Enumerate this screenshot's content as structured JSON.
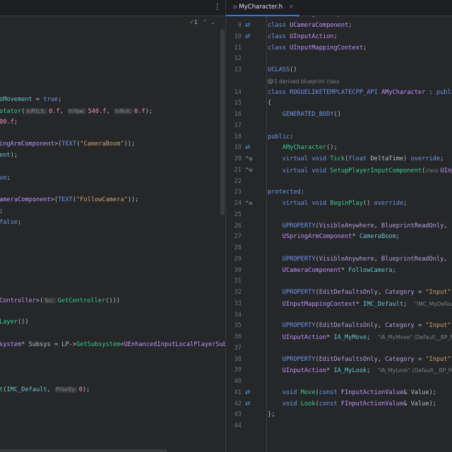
{
  "left_pane": {
    "menu_icon": "kebab-menu-icon",
    "inspection": {
      "count": "1",
      "check_icon": "check-icon",
      "up_icon": "chevron-up-icon",
      "down_icon": "chevron-down-icon"
    },
    "lines": [
      [],
      [],
      [],
      [],
      [],
      [],
      [],
      [
        [
          "oMovement",
          "v"
        ],
        [
          " = ",
          "p"
        ],
        [
          "true",
          "k"
        ],
        [
          ";",
          "p"
        ]
      ],
      [
        [
          "otator",
          "f"
        ],
        [
          "(",
          "p"
        ],
        [
          "InPitch:",
          "h"
        ],
        [
          "0.f",
          "n"
        ],
        [
          ", ",
          "p"
        ],
        [
          "InYaw:",
          "h"
        ],
        [
          "540.f",
          "n"
        ],
        [
          ", ",
          "p"
        ],
        [
          "InRoll:",
          "h"
        ],
        [
          "0.f",
          "n"
        ],
        [
          ");",
          "p"
        ]
      ],
      [
        [
          "00.f",
          "n"
        ],
        [
          ";",
          "p"
        ]
      ],
      [],
      [
        [
          "ingArmComponent",
          "c"
        ],
        [
          ">(",
          "p"
        ],
        [
          "TEXT",
          "m"
        ],
        [
          "(",
          "p"
        ],
        [
          "\"CameraBoom\"",
          "s"
        ],
        [
          "));",
          "p"
        ]
      ],
      [
        [
          "ent",
          "v"
        ],
        [
          ");",
          "p"
        ]
      ],
      [],
      [
        [
          "ue",
          "k"
        ],
        [
          ";",
          "p"
        ]
      ],
      [],
      [
        [
          "ameraComponent",
          "c"
        ],
        [
          ">(",
          "p"
        ],
        [
          "TEXT",
          "m"
        ],
        [
          "(",
          "p"
        ],
        [
          "\"FollowCamera\"",
          "s"
        ],
        [
          "));",
          "p"
        ]
      ],
      [
        [
          ";",
          "p"
        ]
      ],
      [
        [
          "false",
          "k"
        ],
        [
          ";",
          "p"
        ]
      ],
      [],
      [],
      [],
      [],
      [],
      [],
      [
        [
          "Controller",
          "c"
        ],
        [
          ">(",
          "p"
        ],
        [
          "Src:",
          "h"
        ],
        [
          "GetController",
          "f"
        ],
        [
          "()))",
          "p"
        ]
      ],
      [],
      [
        [
          "Layer",
          "f"
        ],
        [
          "())",
          "p"
        ]
      ],
      [],
      [
        [
          "system",
          "c"
        ],
        [
          "* ",
          "p"
        ],
        [
          "Subsys",
          "p"
        ],
        [
          " = LP->",
          "p"
        ],
        [
          "GetSubsystem",
          "f"
        ],
        [
          "<",
          "p"
        ],
        [
          "UEnhancedInputLocalPlayerSub",
          "c"
        ]
      ],
      [],
      [],
      [],
      [
        [
          "t",
          "f"
        ],
        [
          "(",
          "p"
        ],
        [
          "IMC_Default",
          "v"
        ],
        [
          ", ",
          "p"
        ],
        [
          "Priority:",
          "h"
        ],
        [
          "0",
          "n"
        ],
        [
          ");",
          "p"
        ]
      ]
    ]
  },
  "right_pane": {
    "tab": {
      "icon_label": ".H",
      "title": "MyCharacter.h",
      "close": "×"
    },
    "lines": [
      {
        "n": "8",
        "icon": "⇄",
        "t": [
          [
            "class ",
            "k"
          ],
          [
            "USpringArmComponent",
            "c"
          ],
          [
            ";",
            "p"
          ]
        ]
      },
      {
        "n": "9",
        "icon": "⇄",
        "t": [
          [
            "class ",
            "k"
          ],
          [
            "UCameraComponent",
            "c"
          ],
          [
            ";",
            "p"
          ]
        ]
      },
      {
        "n": "10",
        "icon": "⇄",
        "t": [
          [
            "class ",
            "k"
          ],
          [
            "UInputAction",
            "c"
          ],
          [
            ";",
            "p"
          ]
        ]
      },
      {
        "n": "11",
        "t": [
          [
            "class ",
            "k"
          ],
          [
            "UInputMappingContext",
            "c"
          ],
          [
            ";",
            "p"
          ]
        ]
      },
      {
        "n": "12",
        "t": []
      },
      {
        "n": "13",
        "t": [
          [
            "UCLASS",
            "m"
          ],
          [
            "()",
            "p"
          ]
        ]
      },
      {
        "n": "",
        "hint": "1 derived blueprint class",
        "t": []
      },
      {
        "n": "14",
        "t": [
          [
            "class ",
            "k"
          ],
          [
            "ROGUELIKETEMPLATECPP_API ",
            "k"
          ],
          [
            "AMyCharacter",
            "c"
          ],
          [
            " : ",
            "p"
          ],
          [
            "public",
            "k"
          ]
        ]
      },
      {
        "n": "15",
        "t": [
          [
            "{",
            "p"
          ]
        ]
      },
      {
        "n": "16",
        "t": [
          [
            "    ",
            "p"
          ],
          [
            "GENERATED_BODY",
            "m"
          ],
          [
            "()",
            "p"
          ]
        ]
      },
      {
        "n": "17",
        "t": []
      },
      {
        "n": "18",
        "t": [
          [
            "public",
            "k"
          ],
          [
            ":",
            "p"
          ]
        ]
      },
      {
        "n": "19",
        "icon": "⇄",
        "t": [
          [
            "    ",
            "p"
          ],
          [
            "AMyCharacter",
            "f"
          ],
          [
            "();",
            "p"
          ]
        ]
      },
      {
        "n": "20",
        "icon": "^o",
        "t": [
          [
            "    ",
            "p"
          ],
          [
            "virtual void ",
            "k"
          ],
          [
            "Tick",
            "f"
          ],
          [
            "(",
            "p"
          ],
          [
            "float ",
            "k"
          ],
          [
            "DeltaTime",
            "p"
          ],
          [
            ") ",
            "p"
          ],
          [
            "override",
            "k"
          ],
          [
            ";",
            "p"
          ]
        ]
      },
      {
        "n": "21",
        "icon": "^o",
        "t": [
          [
            "    ",
            "p"
          ],
          [
            "virtual void ",
            "k"
          ],
          [
            "SetupPlayerInputComponent",
            "f"
          ],
          [
            "(",
            "p"
          ],
          [
            "class ",
            "g"
          ],
          [
            "UInputComponent",
            "c"
          ]
        ]
      },
      {
        "n": "22",
        "t": []
      },
      {
        "n": "23",
        "t": [
          [
            "protected",
            "k"
          ],
          [
            ":",
            "p"
          ]
        ]
      },
      {
        "n": "24",
        "icon": "^o",
        "t": [
          [
            "    ",
            "p"
          ],
          [
            "virtual void ",
            "k"
          ],
          [
            "BeginPlay",
            "f"
          ],
          [
            "() ",
            "p"
          ],
          [
            "override",
            "k"
          ],
          [
            ";",
            "p"
          ]
        ]
      },
      {
        "n": "25",
        "t": []
      },
      {
        "n": "26",
        "t": [
          [
            "    ",
            "p"
          ],
          [
            "UPROPERTY",
            "m"
          ],
          [
            "(",
            "p"
          ],
          [
            "VisibleAnywhere",
            "a"
          ],
          [
            ", ",
            "p"
          ],
          [
            "BlueprintReadOnly",
            "a"
          ],
          [
            ",",
            "p"
          ]
        ]
      },
      {
        "n": "27",
        "t": [
          [
            "    ",
            "p"
          ],
          [
            "USpringArmComponent",
            "c"
          ],
          [
            "* ",
            "p"
          ],
          [
            "CameraBoom",
            "v"
          ],
          [
            ";",
            "p"
          ]
        ]
      },
      {
        "n": "28",
        "t": []
      },
      {
        "n": "29",
        "t": [
          [
            "    ",
            "p"
          ],
          [
            "UPROPERTY",
            "m"
          ],
          [
            "(",
            "p"
          ],
          [
            "VisibleAnywhere",
            "a"
          ],
          [
            ", ",
            "p"
          ],
          [
            "BlueprintReadOnly",
            "a"
          ],
          [
            ",",
            "p"
          ]
        ]
      },
      {
        "n": "30",
        "t": [
          [
            "    ",
            "p"
          ],
          [
            "UCameraComponent",
            "c"
          ],
          [
            "* ",
            "p"
          ],
          [
            "FollowCamera",
            "v"
          ],
          [
            ";",
            "p"
          ]
        ]
      },
      {
        "n": "31",
        "t": []
      },
      {
        "n": "32",
        "t": [
          [
            "    ",
            "p"
          ],
          [
            "UPROPERTY",
            "m"
          ],
          [
            "(",
            "p"
          ],
          [
            "EditDefaultsOnly",
            "a"
          ],
          [
            ", ",
            "p"
          ],
          [
            "Category",
            "a"
          ],
          [
            " = ",
            "p"
          ],
          [
            "\"Input\"",
            "s"
          ]
        ]
      },
      {
        "n": "33",
        "t": [
          [
            "    ",
            "p"
          ],
          [
            "UInputMappingContext",
            "c"
          ],
          [
            "* ",
            "p"
          ],
          [
            "IMC_Default",
            "v"
          ],
          [
            ";  ",
            "p"
          ],
          [
            "\"IMC_MyDefault\"",
            "g"
          ]
        ]
      },
      {
        "n": "34",
        "t": []
      },
      {
        "n": "35",
        "t": [
          [
            "    ",
            "p"
          ],
          [
            "UPROPERTY",
            "m"
          ],
          [
            "(",
            "p"
          ],
          [
            "EditDefaultsOnly",
            "a"
          ],
          [
            ", ",
            "p"
          ],
          [
            "Category",
            "a"
          ],
          [
            " = ",
            "p"
          ],
          [
            "\"Input\"",
            "s"
          ]
        ]
      },
      {
        "n": "36",
        "t": [
          [
            "    ",
            "p"
          ],
          [
            "UInputAction",
            "c"
          ],
          [
            "* ",
            "p"
          ],
          [
            "IA_MyMove",
            "v"
          ],
          [
            ";  ",
            "p"
          ],
          [
            "\"IA_MyMove\" (Default__BP_MyCharacter_C)",
            "g"
          ]
        ]
      },
      {
        "n": "37",
        "t": []
      },
      {
        "n": "38",
        "t": [
          [
            "    ",
            "p"
          ],
          [
            "UPROPERTY",
            "m"
          ],
          [
            "(",
            "p"
          ],
          [
            "EditDefaultsOnly",
            "a"
          ],
          [
            ", ",
            "p"
          ],
          [
            "Category",
            "a"
          ],
          [
            " = ",
            "p"
          ],
          [
            "\"Input\"",
            "s"
          ]
        ]
      },
      {
        "n": "39",
        "t": [
          [
            "    ",
            "p"
          ],
          [
            "UInputAction",
            "c"
          ],
          [
            "* ",
            "p"
          ],
          [
            "IA_MyLook",
            "v"
          ],
          [
            ";  ",
            "p"
          ],
          [
            "\"IA_MyLook\" (Default__BP_MyCharacter_C)",
            "g"
          ]
        ]
      },
      {
        "n": "40",
        "t": []
      },
      {
        "n": "41",
        "icon": "⇄",
        "t": [
          [
            "    ",
            "p"
          ],
          [
            "void ",
            "k"
          ],
          [
            "Move",
            "f"
          ],
          [
            "(",
            "p"
          ],
          [
            "const ",
            "k"
          ],
          [
            "FInputActionValue",
            "c"
          ],
          [
            "& ",
            "p"
          ],
          [
            "Value",
            "p"
          ],
          [
            ");",
            "p"
          ]
        ]
      },
      {
        "n": "42",
        "icon": "⇄",
        "t": [
          [
            "    ",
            "p"
          ],
          [
            "void ",
            "k"
          ],
          [
            "Look",
            "f"
          ],
          [
            "(",
            "p"
          ],
          [
            "const ",
            "k"
          ],
          [
            "FInputActionValue",
            "c"
          ],
          [
            "& ",
            "p"
          ],
          [
            "Value",
            "p"
          ],
          [
            ");",
            "p"
          ]
        ]
      },
      {
        "n": "43",
        "t": [
          [
            "};",
            "p"
          ]
        ]
      },
      {
        "n": "44",
        "t": []
      }
    ]
  }
}
